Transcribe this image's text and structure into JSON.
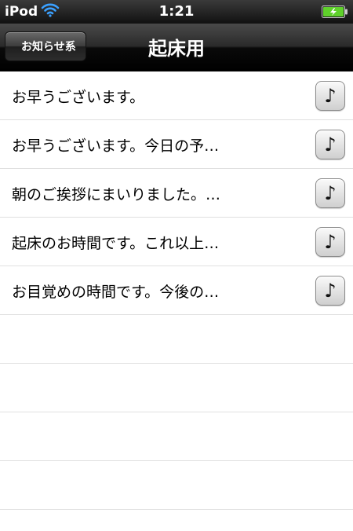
{
  "status_bar": {
    "carrier": "iPod",
    "time": "1:21",
    "wifi_icon": "wifi-icon",
    "battery_icon": "battery-charging-icon"
  },
  "nav": {
    "back_label": "お知らせ系",
    "title": "起床用"
  },
  "list": {
    "items": [
      {
        "label": "お早うございます。",
        "icon": "music-note-icon"
      },
      {
        "label": "お早うございます。今日の予…",
        "icon": "music-note-icon"
      },
      {
        "label": "朝のご挨拶にまいりました。…",
        "icon": "music-note-icon"
      },
      {
        "label": "起床のお時間です。これ以上…",
        "icon": "music-note-icon"
      },
      {
        "label": "お目覚めの時間です。今後の…",
        "icon": "music-note-icon"
      }
    ],
    "note_glyph": "♪"
  },
  "colors": {
    "nav_bg": "#000000",
    "battery_fill": "#5fd12b",
    "separator": "#e0e0e0"
  }
}
